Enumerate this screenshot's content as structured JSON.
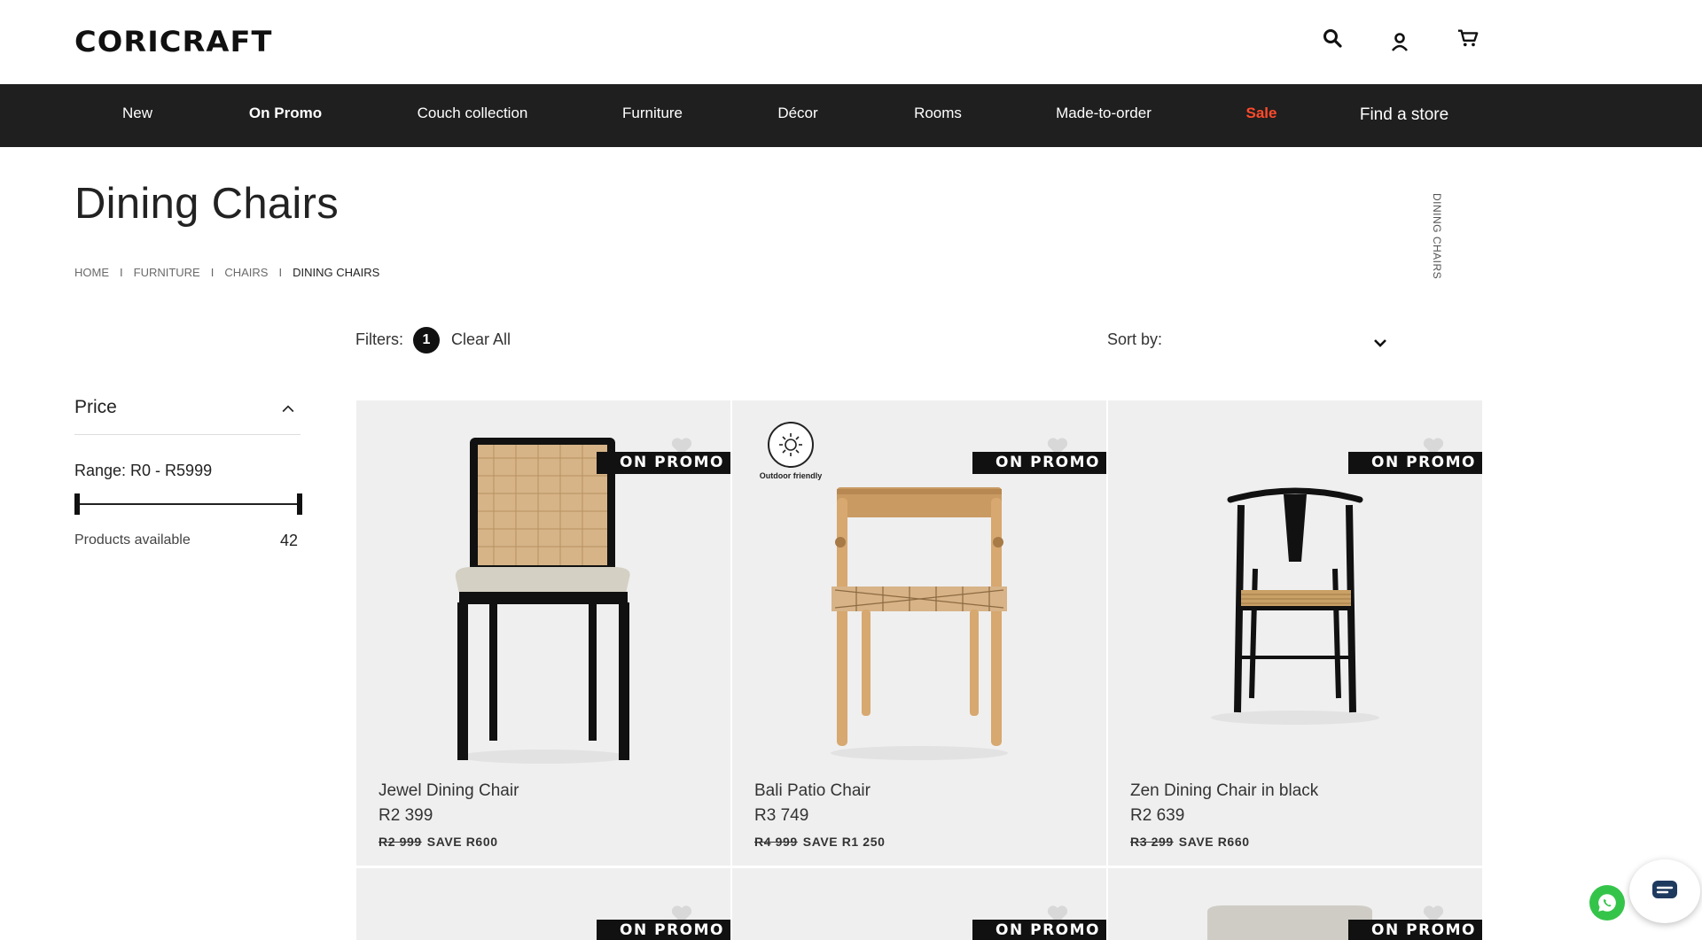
{
  "header": {
    "logo": "CORICRAFT",
    "icons": [
      "search-icon",
      "account-icon",
      "cart-icon"
    ]
  },
  "nav": {
    "items": [
      {
        "label": "New"
      },
      {
        "label": "On Promo"
      },
      {
        "label": "Couch collection"
      },
      {
        "label": "Furniture"
      },
      {
        "label": "Décor"
      },
      {
        "label": "Rooms"
      },
      {
        "label": "Made-to-order"
      },
      {
        "label": "Sale"
      },
      {
        "label": "Find a store"
      }
    ]
  },
  "page": {
    "title": "Dining Chairs",
    "vertical_label": "DINING CHAIRS",
    "breadcrumb": [
      "HOME",
      "FURNITURE",
      "CHAIRS",
      "DINING CHAIRS"
    ],
    "breadcrumb_sep": "I"
  },
  "filters": {
    "label": "Filters:",
    "count": "1",
    "clear_all": "Clear All",
    "sort_label": "Sort by:"
  },
  "sidebar": {
    "price_title": "Price",
    "range_label": "Range: R0 - R5999",
    "range_fraction": [
      0,
      1
    ],
    "products_label": "Products available",
    "products_count": "42"
  },
  "products": [
    {
      "name": "Jewel Dining Chair",
      "price": "R2 399",
      "was": "R2 999",
      "save": "SAVE  R600",
      "badge": "ON PROMO"
    },
    {
      "name": "Bali Patio Chair",
      "price": "R3 749",
      "was": "R4 999",
      "save": "SAVE  R1 250",
      "badge": "ON PROMO",
      "feature": "Outdoor friendly"
    },
    {
      "name": "Zen Dining Chair in black",
      "price": "R2 639",
      "was": "R3 299",
      "save": "SAVE  R660",
      "badge": "ON PROMO"
    },
    {
      "badge": "ON PROMO"
    },
    {
      "badge": "ON PROMO"
    },
    {
      "badge": "ON PROMO"
    }
  ],
  "colors": {
    "nav_bg": "#1f1f1f",
    "sale": "#ff4b2b",
    "card_bg": "#efefef",
    "whatsapp": "#35c44a"
  }
}
